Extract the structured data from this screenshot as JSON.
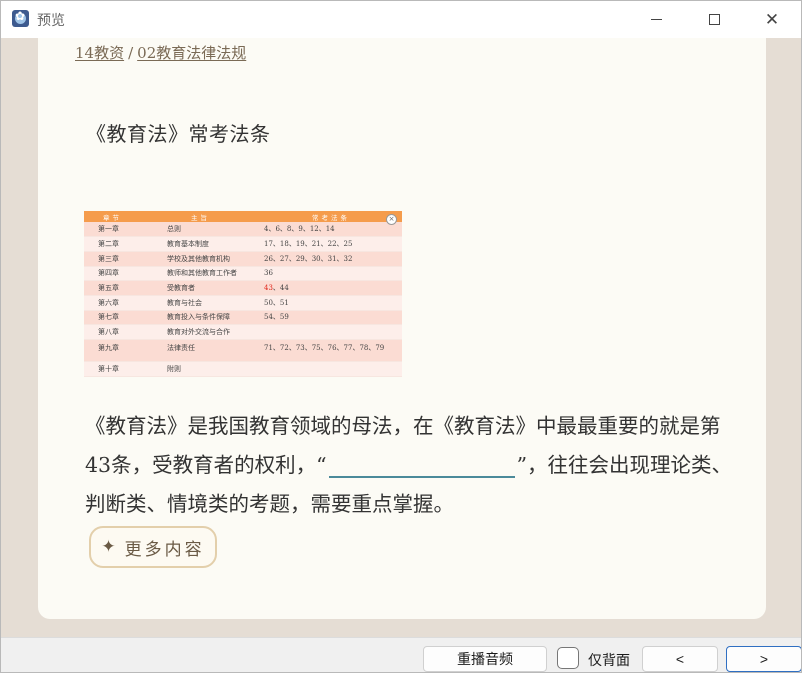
{
  "window": {
    "title": "预览"
  },
  "breadcrumb": {
    "deck": "14教资",
    "separator": "/",
    "subdeck": "02教育法律法规"
  },
  "card": {
    "title": "《教育法》常考法条",
    "paragraph_before_blank": "《教育法》是我国教育领域的母法，在《教育法》中最最重要的就是第43条，受教育者的权利，“",
    "paragraph_after_blank": "”，往往会出现理论类、判断类、情境类的考题，需要重点掌握。",
    "more_button_label": "更多内容",
    "more_button_icon": "sparkle-icon"
  },
  "law_table": {
    "headers": [
      "章节",
      "主旨",
      "常考法条"
    ],
    "rows": [
      {
        "chapter": "第一章",
        "topic": "总则",
        "articles": "4、6、8、9、12、14"
      },
      {
        "chapter": "第二章",
        "topic": "教育基本制度",
        "articles": "17、18、19、21、22、25"
      },
      {
        "chapter": "第三章",
        "topic": "学校及其他教育机构",
        "articles": "26、27、29、30、31、32"
      },
      {
        "chapter": "第四章",
        "topic": "教师和其他教育工作者",
        "articles": "36"
      },
      {
        "chapter": "第五章",
        "topic": "受教育者",
        "articles_highlight": "43",
        "articles_rest": "、44"
      },
      {
        "chapter": "第六章",
        "topic": "教育与社会",
        "articles": "50、51"
      },
      {
        "chapter": "第七章",
        "topic": "教育投入与条件保障",
        "articles": "54、59"
      },
      {
        "chapter": "第八章",
        "topic": "教育对外交流与合作",
        "articles": ""
      },
      {
        "chapter": "第九章",
        "topic": "法律责任",
        "articles": "71、72、73、75、76、77、78、79"
      },
      {
        "chapter": "第十章",
        "topic": "附则",
        "articles": ""
      }
    ],
    "highlight_color": "#e0261b",
    "header_color": "#f59c4c"
  },
  "bottom_bar": {
    "replay_label": "重播音频",
    "back_only_label": "仅背面",
    "prev_label": "<",
    "next_label": ">"
  }
}
